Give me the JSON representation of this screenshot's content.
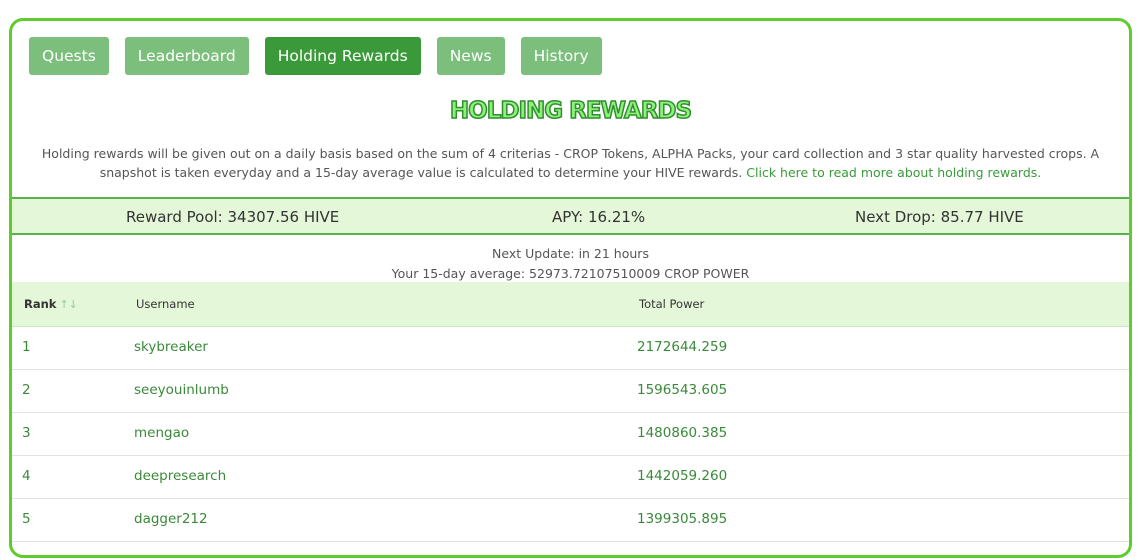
{
  "tabs": [
    {
      "label": "Quests",
      "active": false
    },
    {
      "label": "Leaderboard",
      "active": false
    },
    {
      "label": "Holding Rewards",
      "active": true
    },
    {
      "label": "News",
      "active": false
    },
    {
      "label": "History",
      "active": false
    }
  ],
  "title": "HOLDING REWARDS",
  "description": {
    "text": "Holding rewards will be given out on a daily basis based on the sum of 4 criterias - CROP Tokens, ALPHA Packs, your card collection and 3 star quality harvested crops. A snapshot is taken everyday and a 15-day average value is calculated to determine your HIVE rewards.",
    "link": "Click here to read more about holding rewards."
  },
  "stats": {
    "reward_pool": "Reward Pool: 34307.56 HIVE",
    "apy": "APY: 16.21%",
    "next_drop": "Next Drop: 85.77 HIVE"
  },
  "meta": {
    "next_update": "Next Update: in 21 hours",
    "average": "Your 15-day average: 52973.72107510009 CROP POWER"
  },
  "table": {
    "headers": {
      "rank": "Rank",
      "username": "Username",
      "total_power": "Total Power"
    },
    "sort_icon": "sort-arrows-icon",
    "rows": [
      {
        "rank": "1",
        "username": "skybreaker",
        "power": "2172644.259"
      },
      {
        "rank": "2",
        "username": "seeyouinlumb",
        "power": "1596543.605"
      },
      {
        "rank": "3",
        "username": "mengao",
        "power": "1480860.385"
      },
      {
        "rank": "4",
        "username": "deepresearch",
        "power": "1442059.260"
      },
      {
        "rank": "5",
        "username": "dagger212",
        "power": "1399305.895"
      }
    ]
  },
  "colors": {
    "border": "#5ecb2e",
    "tab": "#7cbf7c",
    "tab_active": "#3a9a3a",
    "stats_bg": "#e5f7d9",
    "link": "#3a9a3a"
  }
}
